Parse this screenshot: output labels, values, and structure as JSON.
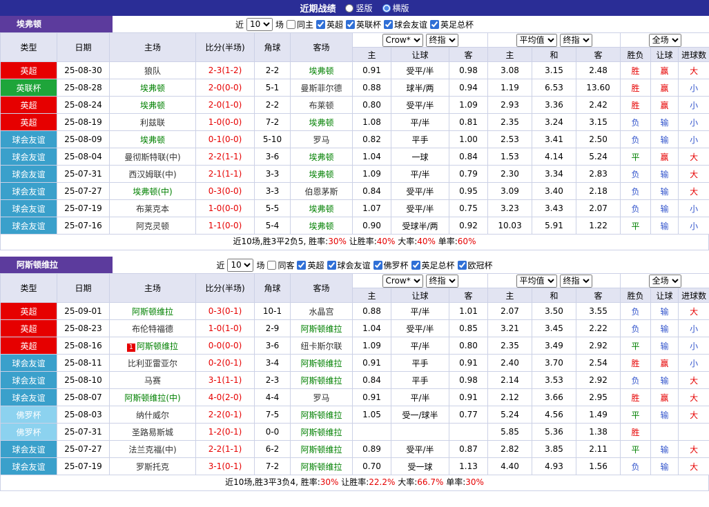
{
  "topbar": {
    "title": "近期战绩",
    "layout_options": [
      {
        "label": "竖版",
        "selected": false
      },
      {
        "label": "横版",
        "selected": true
      }
    ]
  },
  "table_header": {
    "type": "类型",
    "date": "日期",
    "home": "主场",
    "score": "比分(半场)",
    "corner": "角球",
    "away": "客场",
    "odds_sub": [
      "主",
      "让球",
      "客"
    ],
    "avg_sub": [
      "主",
      "和",
      "客"
    ],
    "result_sub": [
      "胜负",
      "让球",
      "进球数"
    ]
  },
  "controls": {
    "bookmaker": "Crow*",
    "bookmaker_stage": "终指",
    "average": "平均值",
    "average_stage": "终指",
    "scope": "全场"
  },
  "colors": {
    "league": {
      "英超": "#e60000",
      "英联杯": "#1ea53a",
      "球会友谊": "#3aa0cb",
      "佛罗杯": "#8cd2ef"
    },
    "result": {
      "胜": "#e60000",
      "负": "#3355cc",
      "平": "#008000",
      "赢": "#e60000",
      "输": "#3355cc",
      "走": "#008000",
      "大": "#e60000",
      "小": "#3355cc"
    },
    "focus_team": "#008000",
    "score": "#e60000"
  },
  "sections": [
    {
      "team": "埃弗顿",
      "filter": {
        "near": "近",
        "count": "10",
        "unit": "场",
        "checkboxes": [
          {
            "label": "同主",
            "checked": false
          },
          {
            "label": "英超",
            "checked": true
          },
          {
            "label": "英联杯",
            "checked": true
          },
          {
            "label": "球会友谊",
            "checked": true
          },
          {
            "label": "英足总杯",
            "checked": true
          }
        ]
      },
      "rows": [
        {
          "type": "英超",
          "date": "25-08-30",
          "home": "狼队",
          "home_focus": false,
          "score": "2-3(1-2)",
          "corner": "2-2",
          "away": "埃弗顿",
          "away_focus": true,
          "odds": [
            "0.91",
            "受平/半",
            "0.98"
          ],
          "avg": [
            "3.08",
            "3.15",
            "2.48"
          ],
          "results": [
            "胜",
            "赢",
            "大"
          ]
        },
        {
          "type": "英联杯",
          "date": "25-08-28",
          "home": "埃弗顿",
          "home_focus": true,
          "score": "2-0(0-0)",
          "corner": "5-1",
          "away": "曼斯菲尔德",
          "away_focus": false,
          "odds": [
            "0.88",
            "球半/两",
            "0.94"
          ],
          "avg": [
            "1.19",
            "6.53",
            "13.60"
          ],
          "results": [
            "胜",
            "赢",
            "小"
          ]
        },
        {
          "type": "英超",
          "date": "25-08-24",
          "home": "埃弗顿",
          "home_focus": true,
          "score": "2-0(1-0)",
          "corner": "2-2",
          "away": "布莱顿",
          "away_focus": false,
          "odds": [
            "0.80",
            "受平/半",
            "1.09"
          ],
          "avg": [
            "2.93",
            "3.36",
            "2.42"
          ],
          "results": [
            "胜",
            "赢",
            "小"
          ]
        },
        {
          "type": "英超",
          "date": "25-08-19",
          "home": "利兹联",
          "home_focus": false,
          "score": "1-0(0-0)",
          "corner": "7-2",
          "away": "埃弗顿",
          "away_focus": true,
          "odds": [
            "1.08",
            "平/半",
            "0.81"
          ],
          "avg": [
            "2.35",
            "3.24",
            "3.15"
          ],
          "results": [
            "负",
            "输",
            "小"
          ]
        },
        {
          "type": "球会友谊",
          "date": "25-08-09",
          "home": "埃弗顿",
          "home_focus": true,
          "score": "0-1(0-0)",
          "corner": "5-10",
          "away": "罗马",
          "away_focus": false,
          "odds": [
            "0.82",
            "平手",
            "1.00"
          ],
          "avg": [
            "2.53",
            "3.41",
            "2.50"
          ],
          "results": [
            "负",
            "输",
            "小"
          ]
        },
        {
          "type": "球会友谊",
          "date": "25-08-04",
          "home": "曼彻斯特联(中)",
          "home_focus": false,
          "score": "2-2(1-1)",
          "corner": "3-6",
          "away": "埃弗顿",
          "away_focus": true,
          "odds": [
            "1.04",
            "一球",
            "0.84"
          ],
          "avg": [
            "1.53",
            "4.14",
            "5.24"
          ],
          "results": [
            "平",
            "赢",
            "大"
          ]
        },
        {
          "type": "球会友谊",
          "date": "25-07-31",
          "home": "西汉姆联(中)",
          "home_focus": false,
          "score": "2-1(1-1)",
          "corner": "3-3",
          "away": "埃弗顿",
          "away_focus": true,
          "odds": [
            "1.09",
            "平/半",
            "0.79"
          ],
          "avg": [
            "2.30",
            "3.34",
            "2.83"
          ],
          "results": [
            "负",
            "输",
            "大"
          ]
        },
        {
          "type": "球会友谊",
          "date": "25-07-27",
          "home": "埃弗顿(中)",
          "home_focus": true,
          "score": "0-3(0-0)",
          "corner": "3-3",
          "away": "伯恩茅斯",
          "away_focus": false,
          "odds": [
            "0.84",
            "受平/半",
            "0.95"
          ],
          "avg": [
            "3.09",
            "3.40",
            "2.18"
          ],
          "results": [
            "负",
            "输",
            "大"
          ]
        },
        {
          "type": "球会友谊",
          "date": "25-07-19",
          "home": "布莱克本",
          "home_focus": false,
          "score": "1-0(0-0)",
          "corner": "5-5",
          "away": "埃弗顿",
          "away_focus": true,
          "odds": [
            "1.07",
            "受平/半",
            "0.75"
          ],
          "avg": [
            "3.23",
            "3.43",
            "2.07"
          ],
          "results": [
            "负",
            "输",
            "小"
          ]
        },
        {
          "type": "球会友谊",
          "date": "25-07-16",
          "home": "阿克灵顿",
          "home_focus": false,
          "score": "1-1(0-0)",
          "corner": "5-4",
          "away": "埃弗顿",
          "away_focus": true,
          "odds": [
            "0.90",
            "受球半/两",
            "0.92"
          ],
          "avg": [
            "10.03",
            "5.91",
            "1.22"
          ],
          "results": [
            "平",
            "输",
            "小"
          ]
        }
      ],
      "summary": [
        {
          "text": "近10场,胜3平2负5, 胜率:",
          "red": false
        },
        {
          "text": "30%",
          "red": true
        },
        {
          "text": " 让胜率:",
          "red": false
        },
        {
          "text": "40%",
          "red": true
        },
        {
          "text": " 大率:",
          "red": false
        },
        {
          "text": "40%",
          "red": true
        },
        {
          "text": " 单率:",
          "red": false
        },
        {
          "text": "60%",
          "red": true
        }
      ]
    },
    {
      "team": "阿斯顿维拉",
      "filter": {
        "near": "近",
        "count": "10",
        "unit": "场",
        "checkboxes": [
          {
            "label": "同客",
            "checked": false
          },
          {
            "label": "英超",
            "checked": true
          },
          {
            "label": "球会友谊",
            "checked": true
          },
          {
            "label": "佛罗杯",
            "checked": true
          },
          {
            "label": "英足总杯",
            "checked": true
          },
          {
            "label": "欧冠杯",
            "checked": true
          }
        ]
      },
      "rows": [
        {
          "type": "英超",
          "date": "25-09-01",
          "home": "阿斯顿维拉",
          "home_focus": true,
          "score": "0-3(0-1)",
          "corner": "10-1",
          "away": "水晶宫",
          "away_focus": false,
          "odds": [
            "0.88",
            "平/半",
            "1.01"
          ],
          "avg": [
            "2.07",
            "3.50",
            "3.55"
          ],
          "results": [
            "负",
            "输",
            "大"
          ]
        },
        {
          "type": "英超",
          "date": "25-08-23",
          "home": "布伦特福德",
          "home_focus": false,
          "score": "1-0(1-0)",
          "corner": "2-9",
          "away": "阿斯顿维拉",
          "away_focus": true,
          "odds": [
            "1.04",
            "受平/半",
            "0.85"
          ],
          "avg": [
            "3.21",
            "3.45",
            "2.22"
          ],
          "results": [
            "负",
            "输",
            "小"
          ]
        },
        {
          "type": "英超",
          "date": "25-08-16",
          "home": "阿斯顿维拉",
          "home_focus": true,
          "home_badge": "1",
          "score": "0-0(0-0)",
          "corner": "3-6",
          "away": "纽卡斯尔联",
          "away_focus": false,
          "odds": [
            "1.09",
            "平/半",
            "0.80"
          ],
          "avg": [
            "2.35",
            "3.49",
            "2.92"
          ],
          "results": [
            "平",
            "输",
            "小"
          ]
        },
        {
          "type": "球会友谊",
          "date": "25-08-11",
          "home": "比利亚雷亚尔",
          "home_focus": false,
          "score": "0-2(0-1)",
          "corner": "3-4",
          "away": "阿斯顿维拉",
          "away_focus": true,
          "odds": [
            "0.91",
            "平手",
            "0.91"
          ],
          "avg": [
            "2.40",
            "3.70",
            "2.54"
          ],
          "results": [
            "胜",
            "赢",
            "小"
          ]
        },
        {
          "type": "球会友谊",
          "date": "25-08-10",
          "home": "马赛",
          "home_focus": false,
          "score": "3-1(1-1)",
          "corner": "2-3",
          "away": "阿斯顿维拉",
          "away_focus": true,
          "odds": [
            "0.84",
            "平手",
            "0.98"
          ],
          "avg": [
            "2.14",
            "3.53",
            "2.92"
          ],
          "results": [
            "负",
            "输",
            "大"
          ]
        },
        {
          "type": "球会友谊",
          "date": "25-08-07",
          "home": "阿斯顿维拉(中)",
          "home_focus": true,
          "score": "4-0(2-0)",
          "corner": "4-4",
          "away": "罗马",
          "away_focus": false,
          "odds": [
            "0.91",
            "平/半",
            "0.91"
          ],
          "avg": [
            "2.12",
            "3.66",
            "2.95"
          ],
          "results": [
            "胜",
            "赢",
            "大"
          ]
        },
        {
          "type": "佛罗杯",
          "date": "25-08-03",
          "home": "纳什威尔",
          "home_focus": false,
          "score": "2-2(0-1)",
          "corner": "7-5",
          "away": "阿斯顿维拉",
          "away_focus": true,
          "odds": [
            "1.05",
            "受一/球半",
            "0.77"
          ],
          "avg": [
            "5.24",
            "4.56",
            "1.49"
          ],
          "results": [
            "平",
            "输",
            "大"
          ]
        },
        {
          "type": "佛罗杯",
          "date": "25-07-31",
          "home": "圣路易斯城",
          "home_focus": false,
          "score": "1-2(0-1)",
          "corner": "0-0",
          "away": "阿斯顿维拉",
          "away_focus": true,
          "odds": [
            "",
            "",
            ""
          ],
          "avg": [
            "5.85",
            "5.36",
            "1.38"
          ],
          "results": [
            "胜",
            "",
            ""
          ]
        },
        {
          "type": "球会友谊",
          "date": "25-07-27",
          "home": "法兰克福(中)",
          "home_focus": false,
          "score": "2-2(1-1)",
          "corner": "6-2",
          "away": "阿斯顿维拉",
          "away_focus": true,
          "odds": [
            "0.89",
            "受平/半",
            "0.87"
          ],
          "avg": [
            "2.82",
            "3.85",
            "2.11"
          ],
          "results": [
            "平",
            "输",
            "大"
          ]
        },
        {
          "type": "球会友谊",
          "date": "25-07-19",
          "home": "罗斯托克",
          "home_focus": false,
          "score": "3-1(0-1)",
          "corner": "7-2",
          "away": "阿斯顿维拉",
          "away_focus": true,
          "odds": [
            "0.70",
            "受一球",
            "1.13"
          ],
          "avg": [
            "4.40",
            "4.93",
            "1.56"
          ],
          "results": [
            "负",
            "输",
            "大"
          ]
        }
      ],
      "summary": [
        {
          "text": "近10场,胜3平3负4, 胜率:",
          "red": false
        },
        {
          "text": "30%",
          "red": true
        },
        {
          "text": " 让胜率:",
          "red": false
        },
        {
          "text": "22.2%",
          "red": true
        },
        {
          "text": " 大率:",
          "red": false
        },
        {
          "text": "66.7%",
          "red": true
        },
        {
          "text": " 单率:",
          "red": false
        },
        {
          "text": "30%",
          "red": true
        }
      ]
    }
  ]
}
